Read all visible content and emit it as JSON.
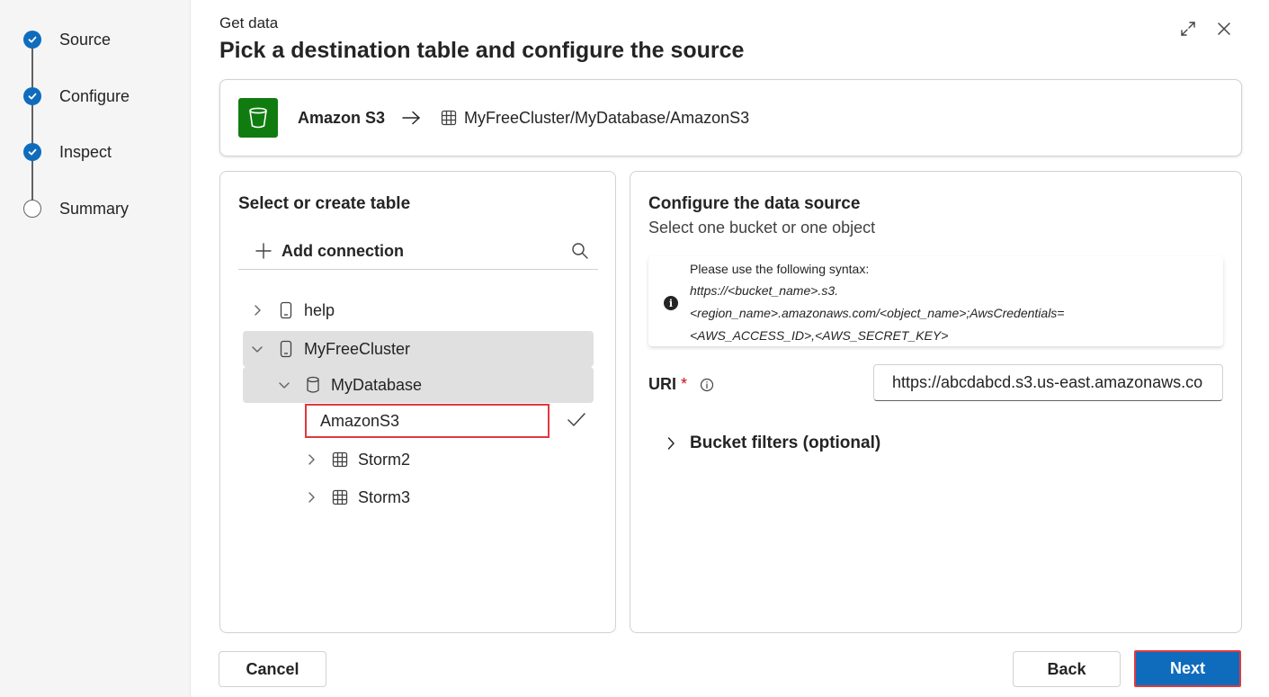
{
  "stepper": {
    "steps": [
      {
        "label": "Source",
        "status": "done"
      },
      {
        "label": "Configure",
        "status": "done"
      },
      {
        "label": "Inspect",
        "status": "done"
      },
      {
        "label": "Summary",
        "status": "pending"
      }
    ]
  },
  "header": {
    "eyebrow": "Get data",
    "title": "Pick a destination table and configure the source"
  },
  "source_card": {
    "source_name": "Amazon S3",
    "destination_path": "MyFreeCluster/MyDatabase/AmazonS3"
  },
  "left_panel": {
    "title": "Select or create table",
    "add_connection_label": "Add connection",
    "tree": {
      "cluster_help": "help",
      "cluster_selected": "MyFreeCluster",
      "database": "MyDatabase",
      "new_table_value": "AmazonS3",
      "table_1": "Storm2",
      "table_2": "Storm3"
    }
  },
  "right_panel": {
    "title": "Configure the data source",
    "subtitle": "Select one bucket or one object",
    "info": {
      "line1": "Please use the following syntax:",
      "line2": "https://<bucket_name>.s3.",
      "line3": "<region_name>.amazonaws.com/<object_name>;AwsCredentials=",
      "line4": "<AWS_ACCESS_ID>,<AWS_SECRET_KEY>"
    },
    "uri_label": "URI",
    "uri_required_mark": "*",
    "uri_value": "https://abcdabcd.s3.us-east.amazonaws.co",
    "bucket_filters_label": "Bucket filters (optional)"
  },
  "footer": {
    "cancel_label": "Cancel",
    "back_label": "Back",
    "next_label": "Next"
  },
  "colors": {
    "accent": "#0f6cbd",
    "s3_tile": "#107c10",
    "highlight_border": "#e0393e",
    "required": "#c50f1f"
  }
}
